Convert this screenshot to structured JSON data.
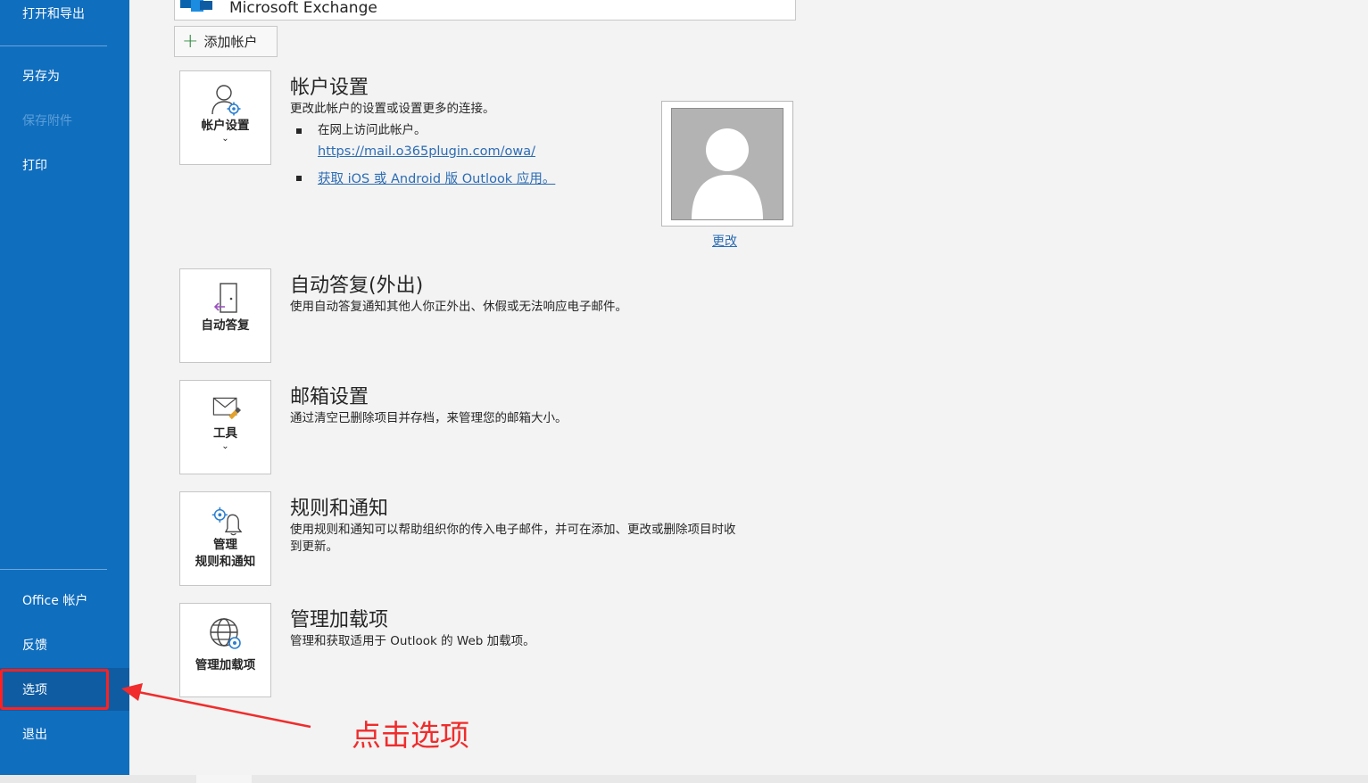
{
  "sidebar": {
    "items": [
      {
        "label": "打开和导出",
        "state": "normal"
      },
      {
        "label": "另存为",
        "state": "normal"
      },
      {
        "label": "保存附件",
        "state": "disabled"
      },
      {
        "label": "打印",
        "state": "normal"
      },
      {
        "label": "Office 帐户",
        "state": "normal"
      },
      {
        "label": "反馈",
        "state": "normal"
      },
      {
        "label": "选项",
        "state": "selected"
      },
      {
        "label": "退出",
        "state": "normal"
      }
    ]
  },
  "account": {
    "selector_label": "Microsoft Exchange",
    "add_account_label": "添加帐户"
  },
  "sections": {
    "account_settings": {
      "tile_label": "帐户设置",
      "title": "帐户设置",
      "description": "更改此帐户的设置或设置更多的连接。",
      "bullet1_text": "在网上访问此帐户。",
      "bullet1_link": "https://mail.o365plugin.com/owa/",
      "bullet2_link": "获取 iOS 或 Android 版 Outlook 应用。",
      "photo_change_label": "更改"
    },
    "auto_reply": {
      "tile_label": "自动答复",
      "title": "自动答复(外出)",
      "description": "使用自动答复通知其他人你正外出、休假或无法响应电子邮件。"
    },
    "mailbox": {
      "tile_label": "工具",
      "title": "邮箱设置",
      "description": "通过清空已删除项目并存档，来管理您的邮箱大小。"
    },
    "rules": {
      "tile_label_line1": "管理",
      "tile_label_line2": "规则和通知",
      "title": "规则和通知",
      "description_line1": "使用规则和通知可以帮助组织你的传入电子邮件，并可在添加、更改或删除项目时收",
      "description_line2": "到更新。"
    },
    "addins": {
      "tile_label": "管理加载项",
      "title": "管理加载项",
      "description": "管理和获取适用于 Outlook 的 Web 加载项。"
    }
  },
  "annotation": {
    "text": "点击选项",
    "color": "#f02c2c"
  },
  "colors": {
    "sidebar_bg": "#106ebe",
    "sidebar_selected": "#0f5ca3",
    "page_bg": "#f3f3f3",
    "link": "#2b6cb5"
  }
}
